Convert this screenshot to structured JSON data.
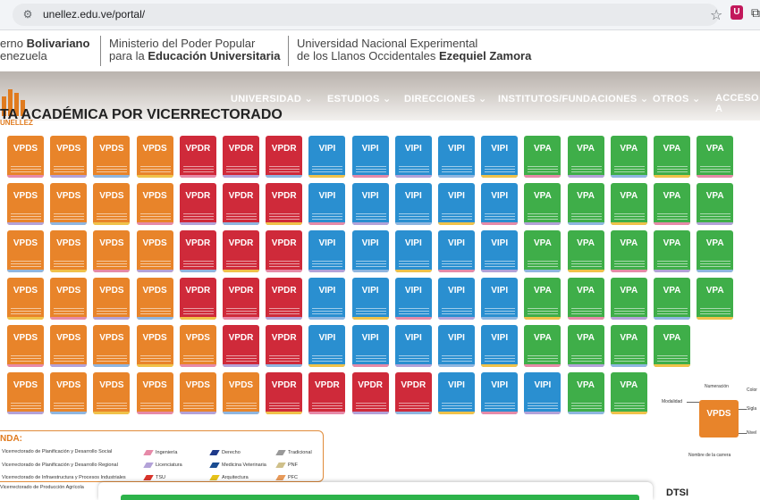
{
  "browser": {
    "url": "unellez.edu.ve/portal/",
    "extension_icon": "shield-icon"
  },
  "header": {
    "gov_line1_pre": "erno ",
    "gov_line1_bold": "Bolivariano",
    "gov_line2": "enezuela",
    "min_line1": "Ministerio del Poder Popular",
    "min_line2_pre": "para la ",
    "min_line2_bold": "Educación Universitaria",
    "uni_line1": "Universidad Nacional Experimental",
    "uni_line2_pre": "de los Llanos Occidentales ",
    "uni_line2_bold": "Ezequiel Zamora"
  },
  "nav": [
    "UNIVERSIDAD ⌄",
    "ESTUDIOS ⌄",
    "DIRECCIONES ⌄",
    "INSTITUTOS/FUNDACIONES ⌄",
    "OTROS ⌄",
    "ACCESO A"
  ],
  "logo_text": "UNELLEZ",
  "page_title": "TA ACADÉMICA POR VICERRECTORADO",
  "colors": {
    "VPDS": "#e8842a",
    "VPDR": "#cf2a3a",
    "VIPI": "#2a8fd0",
    "VPA": "#3fae49"
  },
  "grid": [
    [
      "VPDS",
      "VPDS",
      "VPDS",
      "VPDS",
      "VPDR",
      "VPDR",
      "VPDR",
      "VIPI",
      "VIPI",
      "VIPI",
      "VIPI",
      "VIPI",
      "VPA",
      "VPA",
      "VPA",
      "VPA",
      "VPA"
    ],
    [
      "VPDS",
      "VPDS",
      "VPDS",
      "VPDS",
      "VPDR",
      "VPDR",
      "VPDR",
      "VIPI",
      "VIPI",
      "VIPI",
      "VIPI",
      "VIPI",
      "VPA",
      "VPA",
      "VPA",
      "VPA",
      "VPA"
    ],
    [
      "VPDS",
      "VPDS",
      "VPDS",
      "VPDS",
      "VPDR",
      "VPDR",
      "VPDR",
      "VIPI",
      "VIPI",
      "VIPI",
      "VIPI",
      "VIPI",
      "VPA",
      "VPA",
      "VPA",
      "VPA",
      "VPA"
    ],
    [
      "VPDS",
      "VPDS",
      "VPDS",
      "VPDS",
      "VPDR",
      "VPDR",
      "VPDR",
      "VIPI",
      "VIPI",
      "VIPI",
      "VIPI",
      "VIPI",
      "VPA",
      "VPA",
      "VPA",
      "VPA",
      "VPA"
    ],
    [
      "VPDS",
      "VPDS",
      "VPDS",
      "VPDS",
      "VPDS",
      "VPDR",
      "VPDR",
      "VIPI",
      "VIPI",
      "VIPI",
      "VIPI",
      "VIPI",
      "VPA",
      "VPA",
      "VPA",
      "VPA"
    ],
    [
      "VPDS",
      "VPDS",
      "VPDS",
      "VPDS",
      "VPDS",
      "VPDS",
      "VPDR",
      "VPDR",
      "VPDR",
      "VPDR",
      "VIPI",
      "VIPI",
      "VIPI",
      "VPA",
      "VPA"
    ]
  ],
  "key": {
    "abbr": "VPDS",
    "numeracion": "Numeración",
    "modalidad": "Modalidad",
    "sigla": "Sigla",
    "color": "Color",
    "nivel": "Nivel",
    "nombre": "Nombre de la carrera"
  },
  "legend": {
    "title": "NDA:",
    "items": [
      "Vicerrectorado de Planificación y Desarrollo Social",
      "Vicerrectorado de Planificación y Desarrollo Regional",
      "Vicerrectorado de Infraestructura y Procesos Industriales"
    ],
    "areas": [
      "Ingeniería",
      "Licenciatura",
      "TSU",
      "Derecho",
      "Medicina Veterinaria",
      "Arquitectura",
      "Tradicional",
      "PNF",
      "PFC"
    ]
  },
  "bottom_item": "Vicerrectorado de Producción Agrícola",
  "dtsi": "DTSI"
}
